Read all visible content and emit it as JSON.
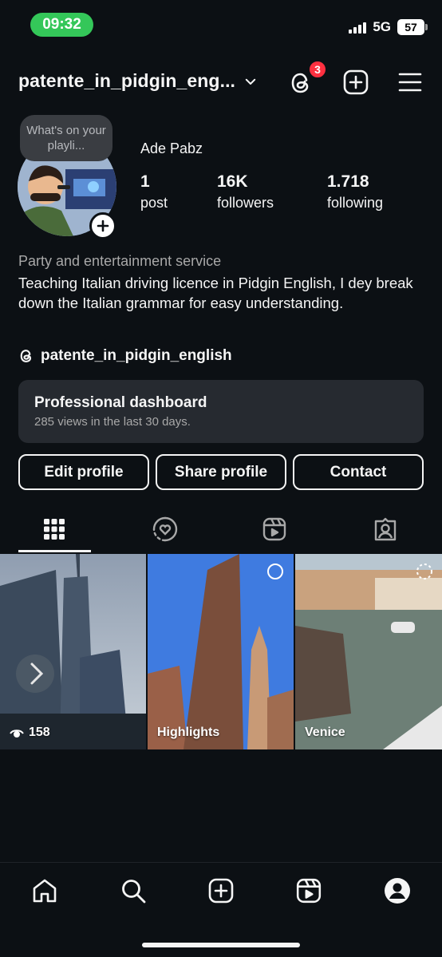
{
  "status_bar": {
    "time": "09:32",
    "network": "5G",
    "battery": "57"
  },
  "header": {
    "username": "patente_in_pidgin_eng...",
    "threads_badge": "3"
  },
  "profile": {
    "note": "What's on your playli...",
    "display_name": "Ade Pabz",
    "stats": [
      {
        "value": "1",
        "label": "post"
      },
      {
        "value": "16K",
        "label": "followers"
      },
      {
        "value": "1.718",
        "label": "following"
      }
    ],
    "category": "Party and entertainment service",
    "bio": "Teaching Italian driving licence in Pidgin English, I dey break down the Italian grammar for easy understanding.",
    "threads_handle": "patente_in_pidgin_english"
  },
  "dashboard": {
    "title": "Professional dashboard",
    "subtitle": "285 views in the last 30 days."
  },
  "buttons": {
    "edit": "Edit profile",
    "share": "Share profile",
    "contact": "Contact"
  },
  "tabs": [
    "grid-icon",
    "collab-icon",
    "reels-icon",
    "tagged-icon"
  ],
  "grid": [
    {
      "label": "158",
      "icon": "eye-icon"
    },
    {
      "label": "Highlights",
      "icon": "heart-circle-icon"
    },
    {
      "label": "Venice",
      "icon": "dashed-circle-icon"
    }
  ],
  "bottom_nav": [
    "home-icon",
    "search-icon",
    "create-icon",
    "reels-icon",
    "profile-icon"
  ],
  "colors": {
    "background": "#0c1014",
    "time_pill": "#34c759",
    "badge": "#ff3040",
    "card": "#262a30"
  }
}
